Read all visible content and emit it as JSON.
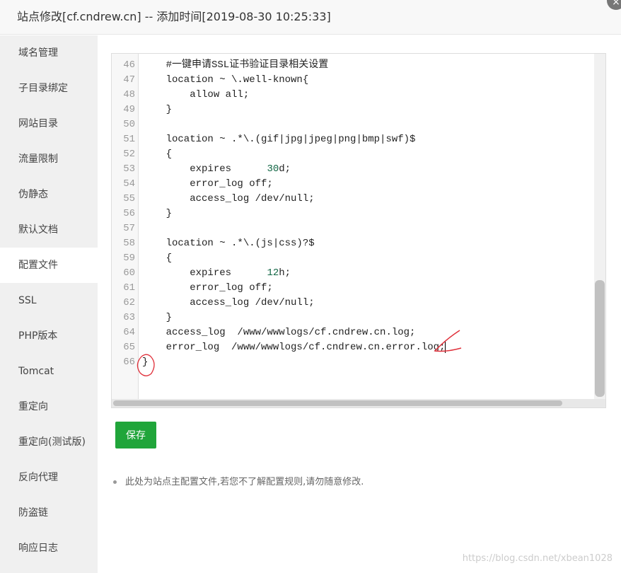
{
  "title": "站点修改[cf.cndrew.cn] -- 添加时间[2019-08-30 10:25:33]",
  "close_icon": "×",
  "sidebar": {
    "items": [
      "域名管理",
      "子目录绑定",
      "网站目录",
      "流量限制",
      "伪静态",
      "默认文档",
      "配置文件",
      "SSL",
      "PHP版本",
      "Tomcat",
      "重定向",
      "重定向(测试版)",
      "反向代理",
      "防盗链",
      "响应日志"
    ],
    "active": "配置文件"
  },
  "editor": {
    "lines": [
      {
        "n": "46",
        "text": "    #一键申请SSL证书验证目录相关设置"
      },
      {
        "n": "47",
        "text": "    location ~ \\.well-known{"
      },
      {
        "n": "48",
        "text": "        allow all;"
      },
      {
        "n": "49",
        "text": "    }"
      },
      {
        "n": "50",
        "text": ""
      },
      {
        "n": "51",
        "text": "    location ~ .*\\.(gif|jpg|jpeg|png|bmp|swf)$"
      },
      {
        "n": "52",
        "text": "    {"
      },
      {
        "n": "53",
        "text": "        expires      30d;"
      },
      {
        "n": "54",
        "text": "        error_log off;"
      },
      {
        "n": "55",
        "text": "        access_log /dev/null;"
      },
      {
        "n": "56",
        "text": "    }"
      },
      {
        "n": "57",
        "text": ""
      },
      {
        "n": "58",
        "text": "    location ~ .*\\.(js|css)?$"
      },
      {
        "n": "59",
        "text": "    {"
      },
      {
        "n": "60",
        "text": "        expires      12h;"
      },
      {
        "n": "61",
        "text": "        error_log off;"
      },
      {
        "n": "62",
        "text": "        access_log /dev/null;"
      },
      {
        "n": "63",
        "text": "    }"
      },
      {
        "n": "64",
        "text": "    access_log  /www/wwwlogs/cf.cndrew.cn.log;"
      },
      {
        "n": "65",
        "text": "    error_log  /www/wwwlogs/cf.cndrew.cn.error.log;"
      },
      {
        "n": "66",
        "text": "}"
      }
    ]
  },
  "save_label": "保存",
  "note": "此处为站点主配置文件,若您不了解配置规则,请勿随意修改.",
  "watermark": "https://blog.csdn.net/xbean1028",
  "colors": {
    "accent": "#20a53a",
    "annotation": "#e0303a"
  }
}
